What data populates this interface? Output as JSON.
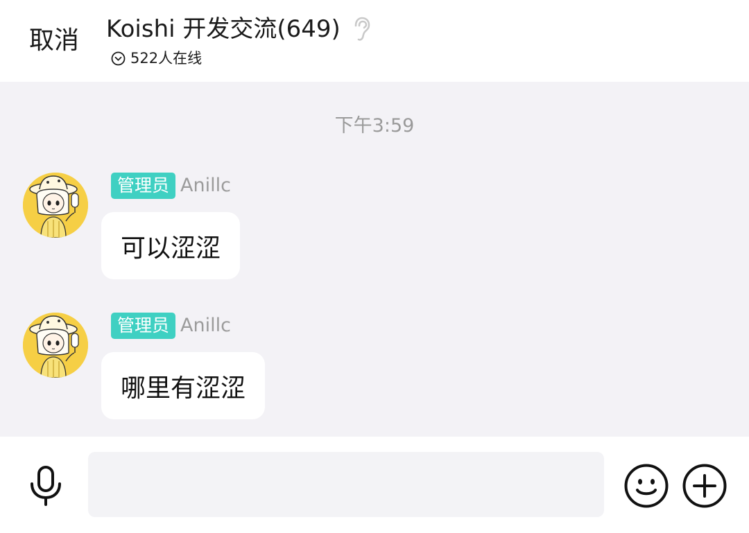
{
  "header": {
    "cancel_label": "取消",
    "group_title": "Koishi 开发交流(649)",
    "online_status": "522人在线",
    "ear_icon": "ear-icon",
    "status_icon": "chevron-down-circle-icon"
  },
  "chat": {
    "timestamp": "下午3:59",
    "messages": [
      {
        "badge": "管理员",
        "sender": "Anillc",
        "text": "可以涩涩"
      },
      {
        "badge": "管理员",
        "sender": "Anillc",
        "text": "哪里有涩涩"
      }
    ]
  },
  "input_bar": {
    "placeholder": "",
    "mic_icon": "microphone-icon",
    "emoji_icon": "smiley-icon",
    "plus_icon": "plus-circle-icon"
  },
  "colors": {
    "badge_bg": "#3fd0c2",
    "chat_bg": "#f3f2f6",
    "avatar_bg": "#f6cf45",
    "muted_text": "#9b9b9b"
  }
}
